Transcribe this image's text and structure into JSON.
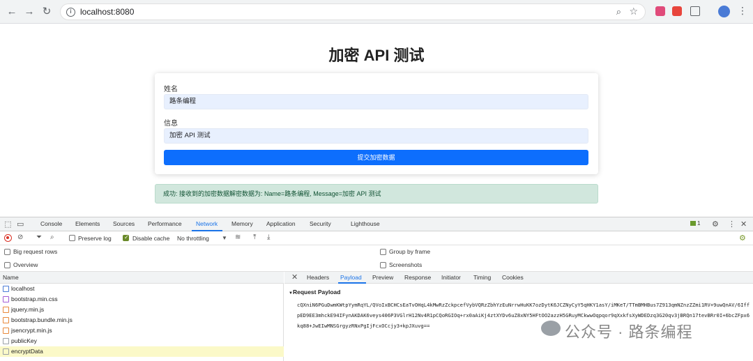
{
  "browser": {
    "url": "localhost:8080"
  },
  "page": {
    "title": "加密 API 测试",
    "name_label": "姓名",
    "name_value": "路条编程",
    "message_label": "信息",
    "message_value": "加密 API 测试",
    "submit_label": "提交加密数据",
    "alert_text": "成功: 接收到的加密数据解密数据为: Name=路条编程, Message=加密 API 测试"
  },
  "devtools": {
    "tabs": [
      "Console",
      "Elements",
      "Sources",
      "Performance",
      "Network",
      "Memory",
      "Application",
      "Security",
      "Lighthouse"
    ],
    "active_tab": "Network",
    "message_count": "1",
    "toolbar": {
      "preserve_log": "Preserve log",
      "disable_cache": "Disable cache",
      "throttling": "No throttling"
    },
    "options": {
      "big_request_rows": "Big request rows",
      "overview": "Overview",
      "group_by_frame": "Group by frame",
      "screenshots": "Screenshots"
    },
    "name_header": "Name",
    "requests": [
      {
        "name": "localhost",
        "color": "#4a7bd6"
      },
      {
        "name": "bootstrap.min.css",
        "color": "#a35bd6"
      },
      {
        "name": "jquery.min.js",
        "color": "#e8883a"
      },
      {
        "name": "bootstrap.bundle.min.js",
        "color": "#e8883a"
      },
      {
        "name": "jsencrypt.min.js",
        "color": "#e8883a"
      },
      {
        "name": "publicKey",
        "color": "#9aa0a6"
      },
      {
        "name": "encryptData",
        "color": "#9aa0a6"
      }
    ],
    "selected_request": "encryptData",
    "detail_tabs": [
      "Headers",
      "Payload",
      "Preview",
      "Response",
      "Initiator",
      "Timing",
      "Cookies"
    ],
    "active_detail_tab": "Payload",
    "payload_title": "Request Payload",
    "payload_text": "cQXniN6PGuDwmKWtpYymRqYL/QVoIxBCHCsEaTvOHqL4kMwRzZckpcefVybVQRzZbhYzEuNrrwHuKK7ozDytK6JCZNyCyY5qHKY1asY/iMKeT/TTmBMHBus7Z913qmNZnzZZmi1RV+9uwQnAV/6IffpED9EE3mhckE94IFynAKDAK6veys406P3VGlrH12Nv4R1pCQoRGIOq+rx0aAiKj4ztXYDv6uZ8xNY5HFtOO2azzH5GRuyMCkwwOqpqor9qXxkfsXyWDEDzq3G20qv3jBRQn17tevBRr0I+6bcZFpx6kq88+JwEIwMNSGrgyzRNxPgIjFcxOCcjy3+kpJXuvg=="
  },
  "watermark": "公众号 · 路条编程"
}
